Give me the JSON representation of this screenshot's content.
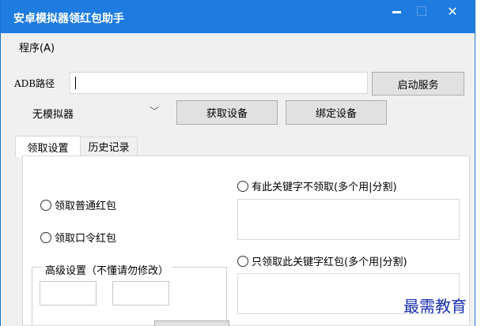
{
  "window": {
    "title": "安卓模拟器领红包助手"
  },
  "menu": {
    "program": "程序(A)"
  },
  "adb": {
    "label": "ADB路径",
    "path_value": ""
  },
  "buttons": {
    "start_service": "启动服务",
    "get_device": "获取设备",
    "bind_device": "绑定设备"
  },
  "emulator_select": {
    "selected": "无模拟器"
  },
  "tabs": [
    {
      "label": "领取设置"
    },
    {
      "label": "历史记录"
    }
  ],
  "settings": {
    "normal_packet": "领取普通红包",
    "password_packet": "领取口令红包",
    "exclude_keyword": "有此关键字不领取(多个用|分割)",
    "include_keyword": "只领取此关键字红包(多个用|分割)",
    "advanced_group": "高级设置（不懂请勿修改）"
  },
  "watermark": "最需教育",
  "colors": {
    "titlebar": "#1e7be0",
    "window_bg": "#f0f0f0",
    "watermark": "#1a2fb0"
  }
}
